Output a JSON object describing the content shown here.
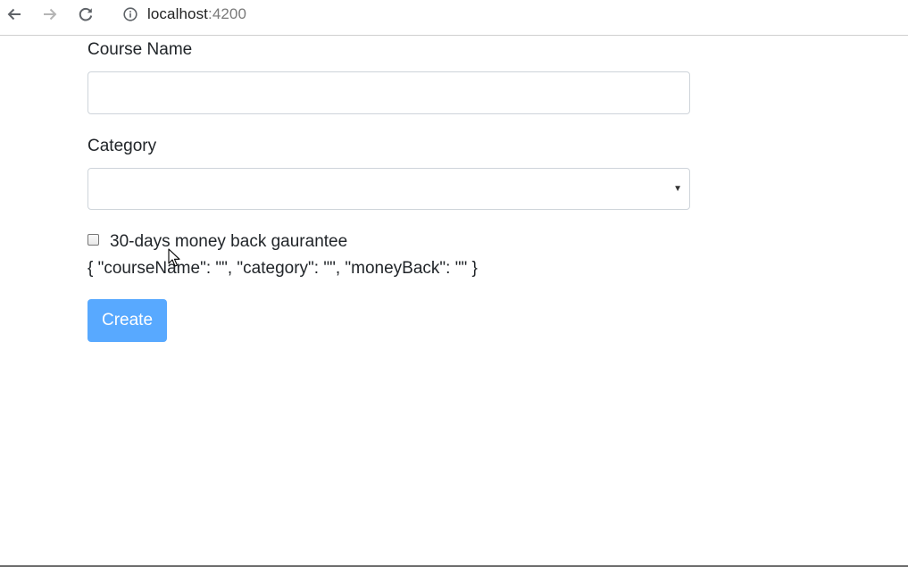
{
  "browser": {
    "url_host": "localhost",
    "url_port": ":4200"
  },
  "form": {
    "course_name_label": "Course Name",
    "course_name_value": "",
    "category_label": "Category",
    "category_value": "",
    "money_back_label": "30-days money back gaurantee",
    "money_back_checked": false,
    "json_output": "{ \"courseName\": \"\", \"category\": \"\", \"moneyBack\": \"\" }",
    "create_label": "Create"
  },
  "colors": {
    "primary_button": "#58a9ff",
    "input_border": "#ced4da"
  },
  "icons": [
    "back-arrow-icon",
    "forward-arrow-icon",
    "reload-icon",
    "info-icon",
    "dropdown-arrow-icon",
    "mouse-cursor-icon"
  ]
}
